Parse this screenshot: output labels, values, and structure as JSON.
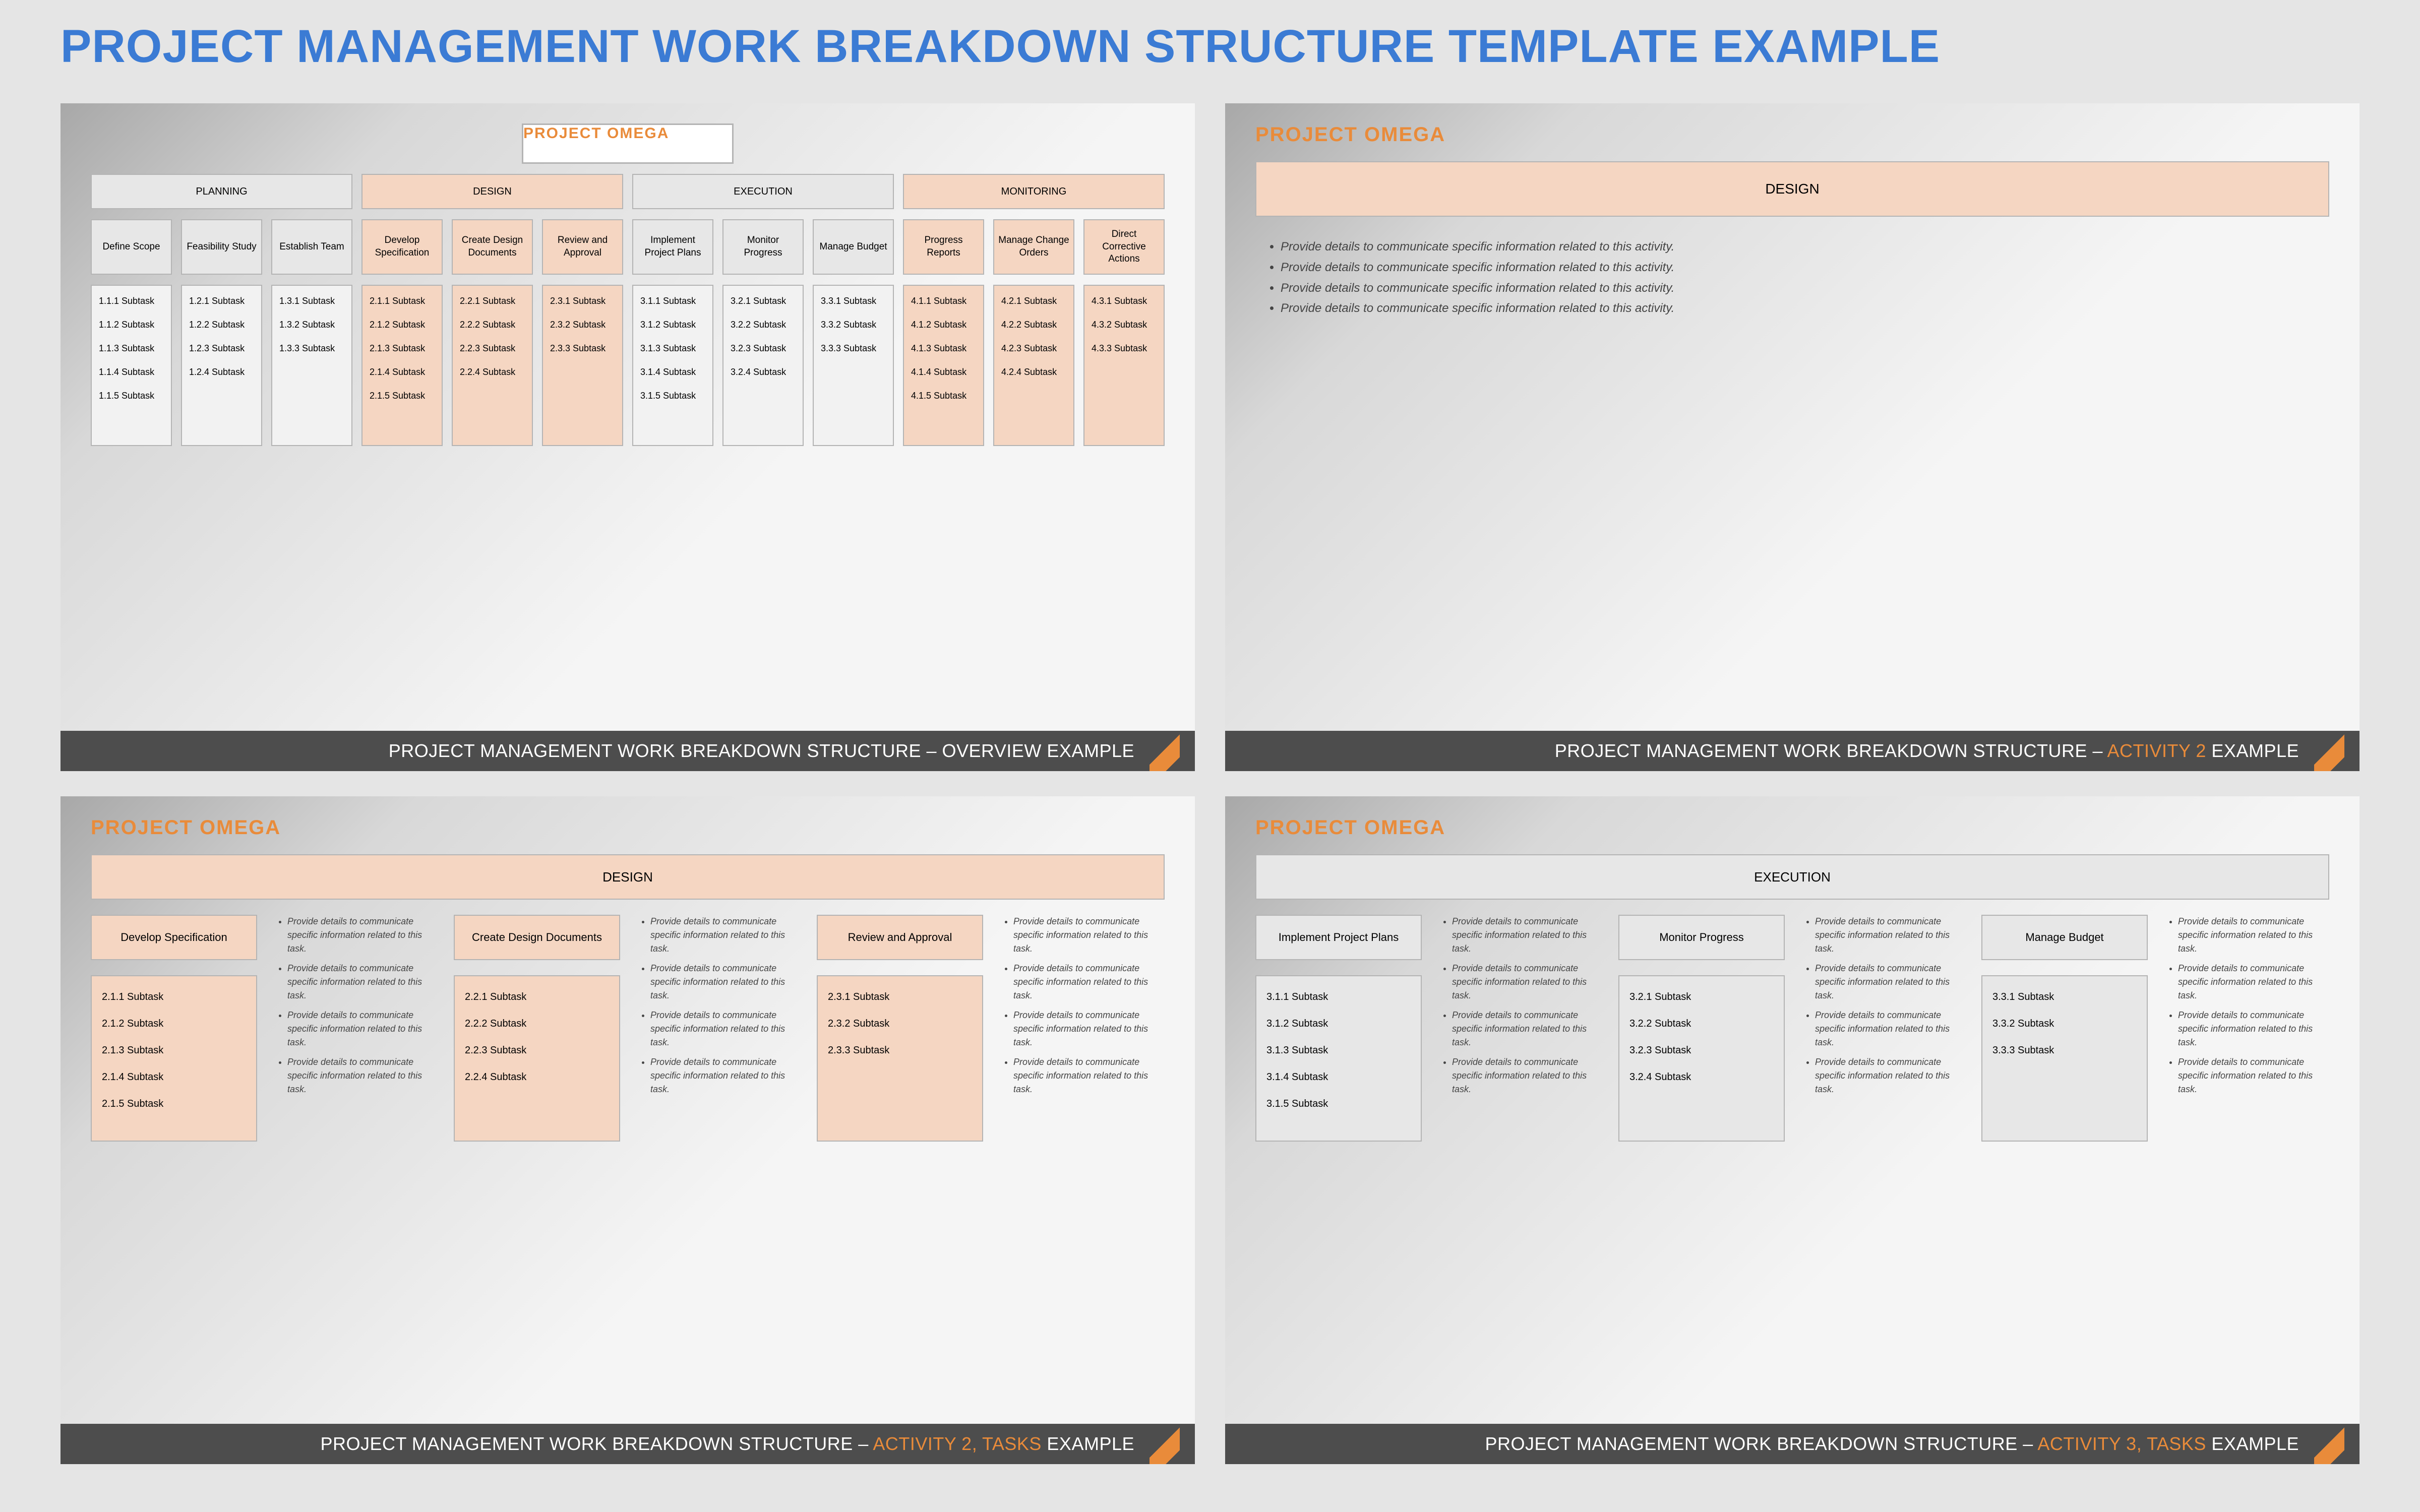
{
  "page_title": "PROJECT MANAGEMENT WORK BREAKDOWN STRUCTURE TEMPLATE EXAMPLE",
  "project_name": "PROJECT OMEGA",
  "footer_base": "PROJECT MANAGEMENT WORK BREAKDOWN STRUCTURE – ",
  "footer_suffix_example": " EXAMPLE",
  "slide1": {
    "footer_label": "OVERVIEW",
    "phases": [
      "PLANNING",
      "DESIGN",
      "EXECUTION",
      "MONITORING"
    ],
    "tasks": [
      [
        {
          "label": "Define Scope"
        },
        {
          "label": "Feasibility Study"
        },
        {
          "label": "Establish Team"
        }
      ],
      [
        {
          "label": "Develop Specification"
        },
        {
          "label": "Create Design Documents"
        },
        {
          "label": "Review and Approval"
        }
      ],
      [
        {
          "label": "Implement Project Plans"
        },
        {
          "label": "Monitor Progress"
        },
        {
          "label": "Manage Budget"
        }
      ],
      [
        {
          "label": "Progress Reports"
        },
        {
          "label": "Manage Change Orders"
        },
        {
          "label": "Direct Corrective Actions"
        }
      ]
    ],
    "subtasks": [
      [
        "1.1.1 Subtask",
        "1.1.2 Subtask",
        "1.1.3 Subtask",
        "1.1.4 Subtask",
        "1.1.5 Subtask"
      ],
      [
        "1.2.1 Subtask",
        "1.2.2 Subtask",
        "1.2.3 Subtask",
        "1.2.4 Subtask"
      ],
      [
        "1.3.1 Subtask",
        "1.3.2 Subtask",
        "1.3.3 Subtask"
      ],
      [
        "2.1.1 Subtask",
        "2.1.2 Subtask",
        "2.1.3 Subtask",
        "2.1.4 Subtask",
        "2.1.5 Subtask"
      ],
      [
        "2.2.1 Subtask",
        "2.2.2 Subtask",
        "2.2.3 Subtask",
        "2.2.4 Subtask"
      ],
      [
        "2.3.1 Subtask",
        "2.3.2 Subtask",
        "2.3.3 Subtask"
      ],
      [
        "3.1.1 Subtask",
        "3.1.2 Subtask",
        "3.1.3 Subtask",
        "3.1.4 Subtask",
        "3.1.5 Subtask"
      ],
      [
        "3.2.1 Subtask",
        "3.2.2 Subtask",
        "3.2.3 Subtask",
        "3.2.4 Subtask"
      ],
      [
        "3.3.1 Subtask",
        "3.3.2 Subtask",
        "3.3.3 Subtask"
      ],
      [
        "4.1.1 Subtask",
        "4.1.2 Subtask",
        "4.1.3 Subtask",
        "4.1.4 Subtask",
        "4.1.5 Subtask"
      ],
      [
        "4.2.1 Subtask",
        "4.2.2 Subtask",
        "4.2.3 Subtask",
        "4.2.4 Subtask"
      ],
      [
        "4.3.1 Subtask",
        "4.3.2 Subtask",
        "4.3.3 Subtask"
      ]
    ]
  },
  "slide2": {
    "footer_label_accent": "ACTIVITY 2",
    "bar_label": "DESIGN",
    "bullet": "Provide details to communicate specific information related to this activity.",
    "bullet_count": 4
  },
  "slide3": {
    "footer_label_accent": "ACTIVITY 2, TASKS",
    "bar_label": "DESIGN",
    "detail_line": "Provide details to communicate specific information related to this task.",
    "detail_count": 4,
    "tasks": [
      {
        "label": "Develop Specification",
        "subs": [
          "2.1.1 Subtask",
          "2.1.2 Subtask",
          "2.1.3 Subtask",
          "2.1.4 Subtask",
          "2.1.5 Subtask"
        ]
      },
      {
        "label": "Create Design Documents",
        "subs": [
          "2.2.1 Subtask",
          "2.2.2 Subtask",
          "2.2.3 Subtask",
          "2.2.4 Subtask"
        ]
      },
      {
        "label": "Review and Approval",
        "subs": [
          "2.3.1 Subtask",
          "2.3.2 Subtask",
          "2.3.3 Subtask"
        ]
      }
    ]
  },
  "slide4": {
    "footer_label_accent": "ACTIVITY 3, TASKS",
    "bar_label": "EXECUTION",
    "detail_line": "Provide details to communicate specific information related to this task.",
    "detail_count": 4,
    "tasks": [
      {
        "label": "Implement Project Plans",
        "subs": [
          "3.1.1 Subtask",
          "3.1.2 Subtask",
          "3.1.3 Subtask",
          "3.1.4 Subtask",
          "3.1.5 Subtask"
        ]
      },
      {
        "label": "Monitor Progress",
        "subs": [
          "3.2.1 Subtask",
          "3.2.2 Subtask",
          "3.2.3 Subtask",
          "3.2.4 Subtask"
        ]
      },
      {
        "label": "Manage Budget",
        "subs": [
          "3.3.1 Subtask",
          "3.3.2 Subtask",
          "3.3.3 Subtask"
        ]
      }
    ]
  }
}
